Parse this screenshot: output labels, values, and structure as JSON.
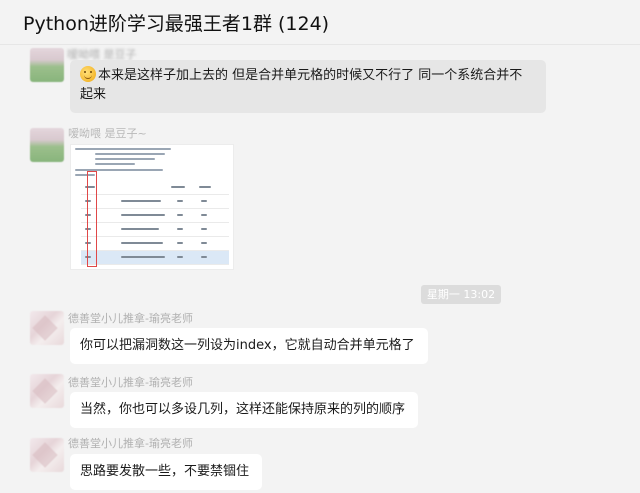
{
  "header": {
    "title": "Python进阶学习最强王者1群 (124)"
  },
  "messages": [
    {
      "sender": "",
      "text": "本来是这样子加上去的 但是合并单元格的时候又不行了  同一个系统合并不起来",
      "line1": "本来是这样子加上去的 但是合并单元格的时候又不行了  同一个系统合并不",
      "line2": "起来",
      "emoji_icon": "sweat-smile-emoji"
    },
    {
      "sender": "嗳呦喂   是豆子~",
      "image_icon": "screenshot-image"
    },
    {
      "sender": "德善堂小儿推拿-瑜亮老师",
      "text": "你可以把漏洞数这一列设为index，它就自动合并单元格了"
    },
    {
      "sender": "德善堂小儿推拿-瑜亮老师",
      "text": "当然，你也可以多设几列，这样还能保持原来的列的顺序"
    },
    {
      "sender": "德善堂小儿推拿-瑜亮老师",
      "text": "思路要发散一些，不要禁锢住"
    }
  ],
  "timestamp": "星期一 13:02",
  "colors": {
    "background": "#f3f3f3",
    "bubble": "#ffffff",
    "bubble_gray": "#e6e6e6",
    "highlight_box": "#e04848"
  }
}
